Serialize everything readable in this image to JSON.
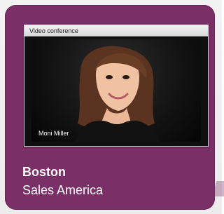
{
  "card": {
    "title": "Boston",
    "subtitle": "Sales America",
    "background_color": "#7a2f66"
  },
  "video_window": {
    "title": "Video conference",
    "participant_name": "Moni Miller"
  }
}
